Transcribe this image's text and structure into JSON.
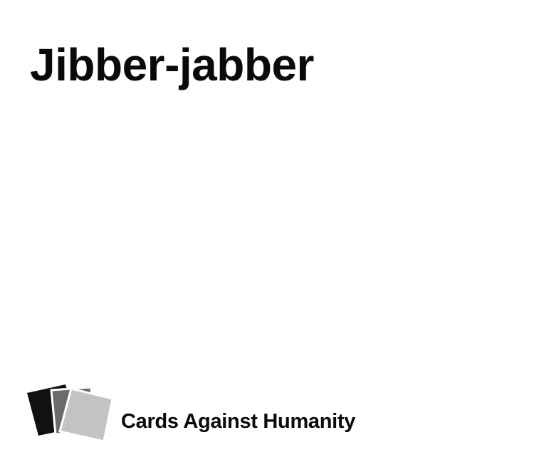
{
  "card": {
    "text": "Jibber-jabber"
  },
  "brand": {
    "name": "Cards Against Humanity",
    "logo_icon": "stacked-cards-icon"
  },
  "colors": {
    "background": "#ffffff",
    "text": "#0a0a0a",
    "logo_card_black": "#111111",
    "logo_card_dark_gray": "#6b6b6b",
    "logo_card_light_gray": "#c3c3c3"
  }
}
